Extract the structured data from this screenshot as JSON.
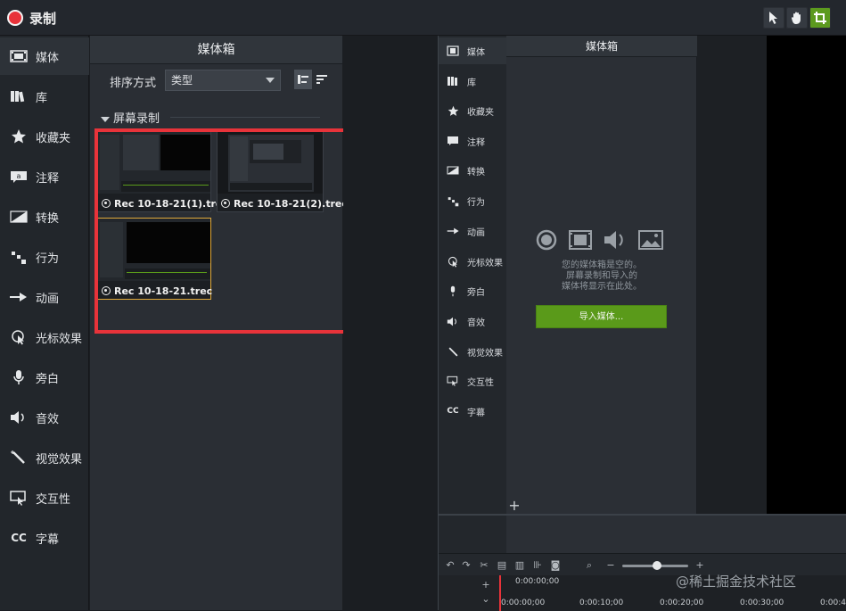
{
  "app": {
    "title": "录制"
  },
  "toolbar": {
    "tools": [
      {
        "name": "select-tool",
        "icon": "pointer-icon",
        "active": false
      },
      {
        "name": "pan-tool",
        "icon": "hand-icon",
        "active": false
      },
      {
        "name": "crop-tool",
        "icon": "crop-icon",
        "active": true
      }
    ]
  },
  "sidebar": {
    "items": [
      {
        "label": "媒体",
        "icon": "filmstrip-icon",
        "active": true
      },
      {
        "label": "库",
        "icon": "library-icon"
      },
      {
        "label": "收藏夹",
        "icon": "star-icon"
      },
      {
        "label": "注释",
        "icon": "annotation-icon"
      },
      {
        "label": "转换",
        "icon": "transition-icon"
      },
      {
        "label": "行为",
        "icon": "behavior-icon"
      },
      {
        "label": "动画",
        "icon": "animation-icon"
      },
      {
        "label": "光标效果",
        "icon": "cursor-effect-icon"
      },
      {
        "label": "旁白",
        "icon": "microphone-icon"
      },
      {
        "label": "音效",
        "icon": "speaker-icon"
      },
      {
        "label": "视觉效果",
        "icon": "magic-wand-icon"
      },
      {
        "label": "交互性",
        "icon": "interactive-icon"
      },
      {
        "label": "字幕",
        "icon": "cc-icon"
      }
    ]
  },
  "bin": {
    "title": "媒体箱",
    "sort_label": "排序方式",
    "sort_value": "类型",
    "section": "屏幕录制",
    "clips": [
      {
        "name": "Rec 10-18-21(1).trec",
        "selected": false
      },
      {
        "name": "Rec 10-18-21(2).trec",
        "selected": false
      },
      {
        "name": "Rec 10-18-21.trec",
        "selected": true
      }
    ],
    "highlight_color": "#e8333a"
  },
  "embedded": {
    "sidebar": [
      "媒体",
      "库",
      "收藏夹",
      "注释",
      "转换",
      "行为",
      "动画",
      "光标效果",
      "旁白",
      "音效",
      "视觉效果",
      "交互性",
      "字幕"
    ],
    "cc_glyph": "CC",
    "bin_title": "媒体箱",
    "empty_message": [
      "您的媒体箱是空的。",
      "屏幕录制和导入的",
      "媒体将显示在此处。"
    ],
    "import_button": "导入媒体...",
    "add_glyph": "+",
    "timeline": {
      "times": [
        "0:00:00;00",
        "0:00:00;00",
        "0:00:10;00",
        "0:00:20;00",
        "0:00:30;00",
        "0:00:40;00"
      ]
    }
  },
  "watermark": "@稀土掘金技术社区",
  "colors": {
    "accent": "#5c9a1e",
    "record": "#e8333a",
    "selected": "#e0a93a"
  }
}
